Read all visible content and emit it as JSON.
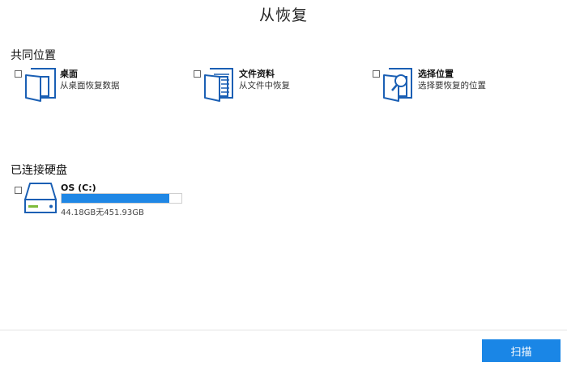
{
  "window": {
    "title": "从恢复"
  },
  "common_locations": {
    "heading": "共同位置",
    "items": [
      {
        "title": "桌面",
        "description": "从桌面恢复数据",
        "icon": "desktop-folder-icon"
      },
      {
        "title": "文件资料",
        "description": "从文件中恢复",
        "icon": "documents-icon"
      },
      {
        "title": "选择位置",
        "description": "选择要恢复的位置",
        "icon": "choose-location-icon"
      }
    ]
  },
  "connected_drives": {
    "heading": "已连接硬盘",
    "drives": [
      {
        "name": "OS (C:)",
        "usage_text": "44.18GB无451.93GB",
        "used_fraction": 0.9,
        "icon": "hard-drive-icon"
      }
    ]
  },
  "footer": {
    "scan_label": "扫描"
  },
  "colors": {
    "accent": "#1a86e6",
    "icon_stroke": "#1a5fb4",
    "drive_led": "#7dbb3a"
  }
}
